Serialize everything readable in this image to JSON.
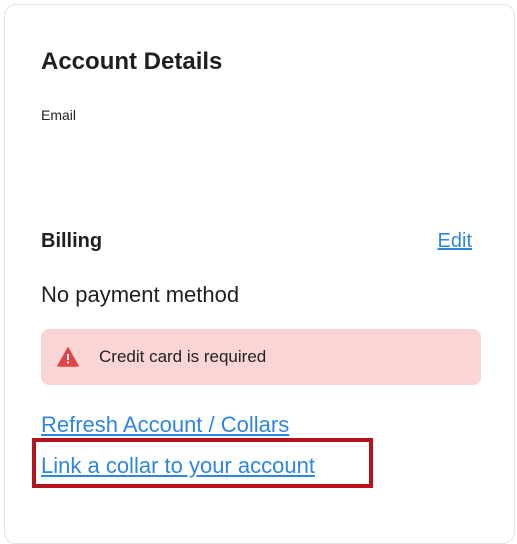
{
  "account": {
    "title": "Account Details",
    "email_label": "Email"
  },
  "billing": {
    "title": "Billing",
    "edit_label": "Edit",
    "payment_status": "No payment method",
    "alert": {
      "icon": "warning-triangle-icon",
      "text": "Credit card is required",
      "background_color": "#fbd5d5",
      "icon_color": "#e04444"
    }
  },
  "links": {
    "refresh_label": "Refresh Account / Collars",
    "link_collar_label": "Link a collar to your account"
  },
  "colors": {
    "link": "#2f86df",
    "highlight": "#b5121b"
  }
}
